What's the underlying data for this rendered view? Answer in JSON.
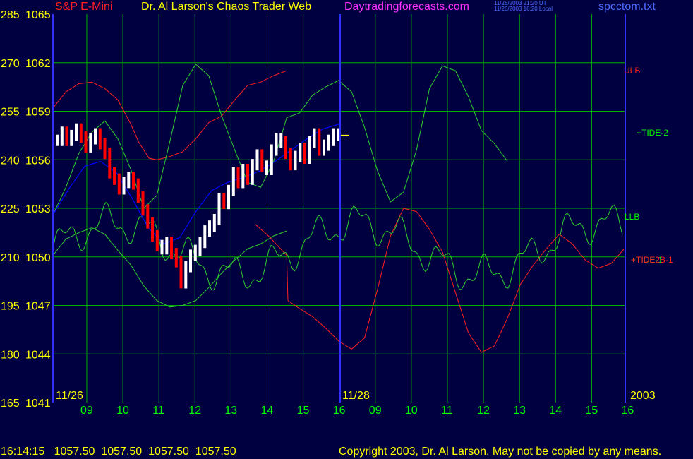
{
  "header": {
    "instrument": "S&P E-Mini",
    "site_title": "Dr. Al Larson's Chaos Trader Web",
    "site_url": "Daytradingforecasts.com",
    "timestamp_ut": "11/26/2003 21:20 UT",
    "timestamp_local": "11/26/2003 16:20 Local",
    "filename": "spcctom.txt"
  },
  "footer": {
    "quote": "16:14:15   1057.50  1057.50  1057.50  1057.50",
    "copyright": "Copyright 2003, Dr. Al Larson. May not be copied by any means."
  },
  "colors": {
    "background": "#000040",
    "grid": "#00b000",
    "axis": "#3030ff",
    "price_up": "#ffffff",
    "price_down": "#ff0000",
    "band": "#ff2020",
    "tide": "#30d030",
    "moving_avg": "#0000ff",
    "label_yellow": "#ffff00",
    "label_green": "#00ff00"
  },
  "chart_data": {
    "type": "line",
    "left_axis_labels": [
      "285",
      "270",
      "255",
      "240",
      "225",
      "210",
      "195",
      "180",
      "165"
    ],
    "price_axis_labels": [
      "1065",
      "1062",
      "1059",
      "1056",
      "1053",
      "1050",
      "1047",
      "1044",
      "1041"
    ],
    "price_range": [
      1041,
      1065
    ],
    "tide_range": [
      165,
      285
    ],
    "x_hours": [
      "09",
      "10",
      "11",
      "12",
      "13",
      "14",
      "15",
      "16",
      "09",
      "10",
      "11",
      "12",
      "13",
      "14",
      "15",
      "16"
    ],
    "date_labels": [
      "11/26",
      "11/28"
    ],
    "year_label": "2003",
    "last_price": 1057.5,
    "series_labels": {
      "ulb": "ULB",
      "tide2": "+TIDE-2",
      "llb": "LLB",
      "tide1": "+TIDE-1",
      "tide2b": "+TIDE2B-1"
    },
    "grid": true,
    "series": [
      {
        "name": "ULB",
        "color": "#ff2020",
        "points": [
          [
            0,
            1059.2
          ],
          [
            0.5,
            1060.2
          ],
          [
            1,
            1060.7
          ],
          [
            1.5,
            1060.8
          ],
          [
            2,
            1060.4
          ],
          [
            2.5,
            1059.7
          ],
          [
            3,
            1058.2
          ],
          [
            3.3,
            1057.1
          ],
          [
            3.7,
            1056.1
          ],
          [
            4,
            1056
          ],
          [
            4.5,
            1056.2
          ],
          [
            5,
            1056.5
          ],
          [
            5.5,
            1057.3
          ],
          [
            6,
            1058.3
          ],
          [
            6.5,
            1058.7
          ],
          [
            7,
            1059.7
          ],
          [
            7.5,
            1060.6
          ],
          [
            8,
            1060.8
          ],
          [
            8.5,
            1061.2
          ],
          [
            9,
            1061.5
          ]
        ]
      },
      {
        "name": "TIDE-2",
        "color": "#30d030",
        "points": [
          [
            0,
            1052.6
          ],
          [
            0.5,
            1054.3
          ],
          [
            1,
            1056.4
          ],
          [
            1.5,
            1057.7
          ],
          [
            2,
            1058.4
          ],
          [
            2.5,
            1057.3
          ],
          [
            3,
            1055.4
          ],
          [
            3.5,
            1053
          ],
          [
            4,
            1053.8
          ],
          [
            4.5,
            1057.1
          ],
          [
            5,
            1060.6
          ],
          [
            5.5,
            1061.9
          ],
          [
            6,
            1061.2
          ],
          [
            6.5,
            1058.7
          ],
          [
            7,
            1056.6
          ],
          [
            7.5,
            1054.6
          ],
          [
            8,
            1054.3
          ],
          [
            8.5,
            1055.9
          ],
          [
            9,
            1058.6
          ],
          [
            9.5,
            1058.9
          ],
          [
            10,
            1060
          ],
          [
            10.5,
            1060.5
          ],
          [
            11,
            1060.9
          ],
          [
            11.5,
            1060.2
          ],
          [
            12,
            1058
          ],
          [
            12.5,
            1055.3
          ],
          [
            13,
            1053.4
          ],
          [
            13.5,
            1054
          ],
          [
            14,
            1056.6
          ],
          [
            14.5,
            1060.4
          ],
          [
            15,
            1061.8
          ],
          [
            15.5,
            1061.5
          ],
          [
            16,
            1059.9
          ],
          [
            16.5,
            1057.8
          ],
          [
            17,
            1057
          ],
          [
            17.5,
            1055.9
          ]
        ]
      },
      {
        "name": "LLB",
        "color": "#30d030",
        "points": [
          [
            0,
            1050.1
          ],
          [
            0.5,
            1051.1
          ],
          [
            1,
            1051.5
          ],
          [
            1.5,
            1051.8
          ],
          [
            2,
            1051.4
          ],
          [
            2.5,
            1050.4
          ],
          [
            3,
            1049.5
          ],
          [
            3.5,
            1048.2
          ],
          [
            4,
            1047.3
          ],
          [
            4.5,
            1046.9
          ],
          [
            5,
            1047
          ],
          [
            5.5,
            1047.3
          ],
          [
            6,
            1048.1
          ],
          [
            6.5,
            1049
          ],
          [
            7,
            1049.8
          ],
          [
            7.5,
            1050.5
          ],
          [
            8,
            1050.8
          ],
          [
            8.5,
            1051.3
          ],
          [
            9,
            1051.6
          ]
        ]
      },
      {
        "name": "TIDE-1",
        "color": "#ff2020",
        "points": [
          [
            7.8,
            1052
          ],
          [
            8.3,
            1051.3
          ],
          [
            9,
            1050.1
          ],
          [
            9.05,
            1047.3
          ],
          [
            9.5,
            1046.8
          ],
          [
            10,
            1046.3
          ],
          [
            10.5,
            1045.6
          ],
          [
            11,
            1044.8
          ],
          [
            11.5,
            1044.3
          ],
          [
            12,
            1045
          ],
          [
            12.5,
            1048
          ],
          [
            13,
            1051.3
          ],
          [
            13.5,
            1053
          ],
          [
            14,
            1052.8
          ],
          [
            14.5,
            1051.7
          ],
          [
            15,
            1050.3
          ],
          [
            15.5,
            1047.8
          ],
          [
            16,
            1045.3
          ],
          [
            16.5,
            1044.1
          ],
          [
            17,
            1044.5
          ],
          [
            17.5,
            1046.2
          ],
          [
            18,
            1048.3
          ],
          [
            18.5,
            1049.5
          ],
          [
            19,
            1050.5
          ],
          [
            19.5,
            1051.4
          ],
          [
            20,
            1050.8
          ],
          [
            20.5,
            1049.8
          ],
          [
            21,
            1049.3
          ],
          [
            21.5,
            1049.6
          ],
          [
            22,
            1050.5
          ]
        ]
      }
    ]
  }
}
